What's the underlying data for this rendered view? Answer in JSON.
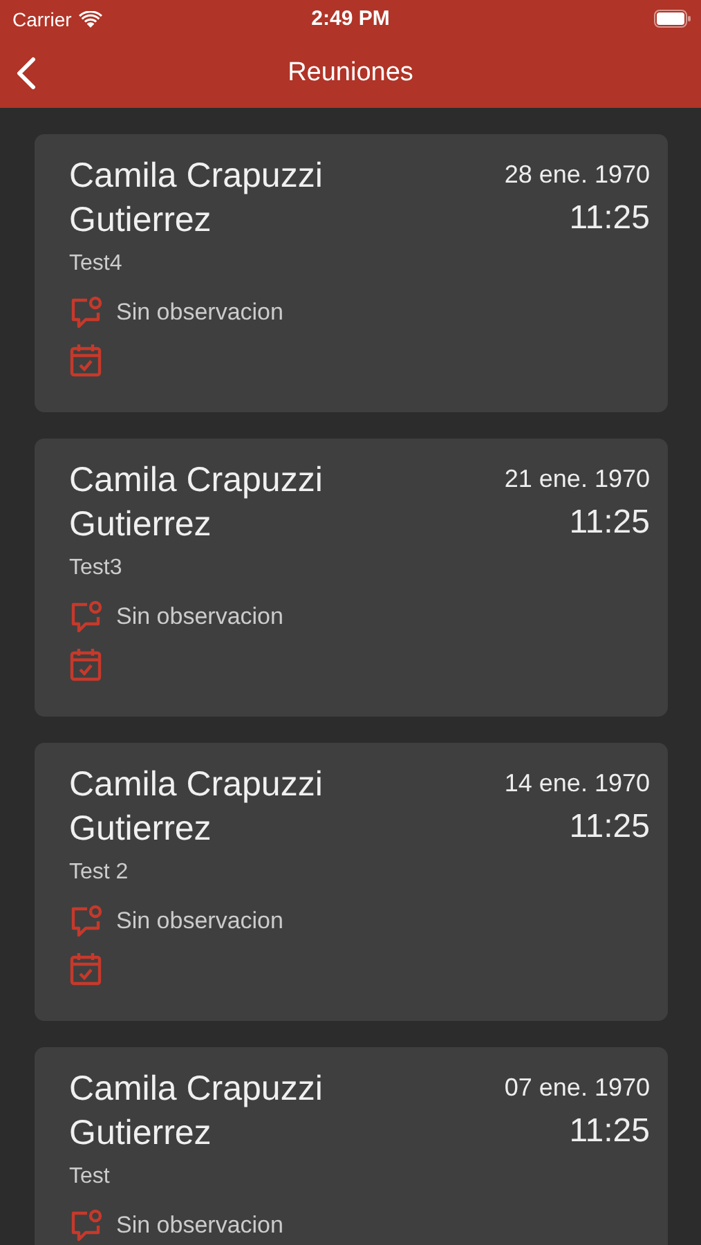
{
  "status_bar": {
    "carrier": "Carrier",
    "time": "2:49 PM"
  },
  "nav": {
    "title": "Reuniones"
  },
  "meetings": [
    {
      "name": "Camila Crapuzzi Gutierrez",
      "date": "28 ene. 1970",
      "time": "11:25",
      "subject": "Test4",
      "observation": "Sin observacion"
    },
    {
      "name": "Camila Crapuzzi Gutierrez",
      "date": "21 ene. 1970",
      "time": "11:25",
      "subject": "Test3",
      "observation": "Sin observacion"
    },
    {
      "name": "Camila Crapuzzi Gutierrez",
      "date": "14 ene. 1970",
      "time": "11:25",
      "subject": "Test 2",
      "observation": "Sin observacion"
    },
    {
      "name": "Camila Crapuzzi Gutierrez",
      "date": "07 ene. 1970",
      "time": "11:25",
      "subject": "Test",
      "observation": "Sin observacion"
    }
  ]
}
